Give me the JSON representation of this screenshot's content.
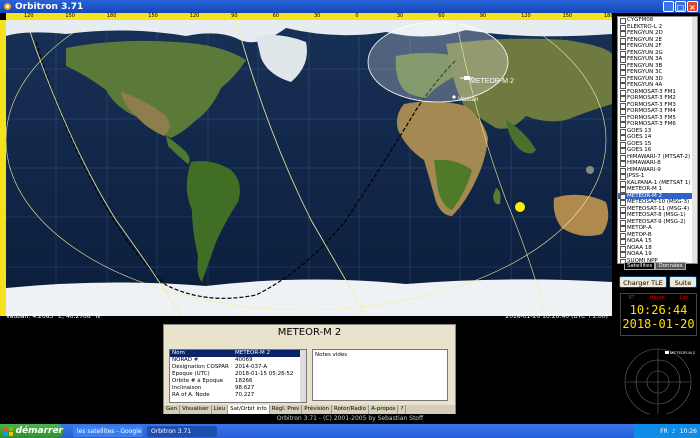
{
  "window": {
    "title": "Orbitron 3.71"
  },
  "map": {
    "top_scale": [
      "120",
      "150",
      "180",
      "150",
      "120",
      "90",
      "60",
      "30",
      "0",
      "30",
      "60",
      "90",
      "120",
      "150",
      "180"
    ],
    "satellite_label": "METEOR-M 2",
    "observer_label": "Vauban",
    "location_readout": "Vauban: 4.2083° E, 46.2708° N",
    "datetime_readout": "2018-01-20 10:26:40 (UTC +1:00)"
  },
  "panel": {
    "title": "METEOR-M 2",
    "table": [
      {
        "k": "Nom",
        "v": "METEOR-M 2"
      },
      {
        "k": "NORAD #",
        "v": "40069"
      },
      {
        "k": "Désignation COSPAR",
        "v": "2014-037-A"
      },
      {
        "k": "Epoque (UTC)",
        "v": "2018-01-15 05:26:52"
      },
      {
        "k": "Orbite # à Epoque",
        "v": "18266"
      },
      {
        "k": "Inclinaison",
        "v": "98.627"
      },
      {
        "k": "RA of A. Node",
        "v": "70.227"
      }
    ],
    "notes": "Notes vides",
    "tabs": [
      "Gen",
      "Visualiser",
      "Lieu",
      "Sat/Orbit info",
      "Régl. Prev",
      "Prévision",
      "Rotor/Radio",
      "A-propos",
      "?"
    ]
  },
  "satellites": [
    "CYGFM08",
    "ELEKTRO-L 2",
    "FENGYUN 2D",
    "FENGYUN 2E",
    "FENGYUN 2F",
    "FENGYUN 2G",
    "FENGYUN 3A",
    "FENGYUN 3B",
    "FENGYUN 3C",
    "FENGYUN 3D",
    "FENGYUN 4A",
    "FORMOSAT-3 FM1",
    "FORMOSAT-3 FM2",
    "FORMOSAT-3 FM3",
    "FORMOSAT-3 FM4",
    "FORMOSAT-3 FM5",
    "FORMOSAT-3 FM6",
    "GOES 13",
    "GOES 14",
    "GOES 15",
    "GOES 16",
    "HIMAWARI-7 (MTSAT-2)",
    "HIMAWARI-8",
    "HIMAWARI-9",
    "JPSS-1",
    "KALPANA-1 (METSAT 1)",
    "METEOR-M 1",
    "METEOR-M 2",
    "METEOSAT-10 (MSG-3)",
    "METEOSAT-11 (MSG-4)",
    "METEOSAT-8 (MSG-1)",
    "METEOSAT-9 (MSG-2)",
    "METOP-A",
    "METOP-B",
    "NOAA 15",
    "NOAA 18",
    "NOAA 19",
    "SUOMI NPP"
  ],
  "selected_index": 27,
  "checked_index": 27,
  "list_tabs": [
    "Satellites",
    "Données"
  ],
  "buttons": {
    "load_tle": "Charger TLE",
    "next": "Suite"
  },
  "clock": {
    "labels": [
      "RT",
      "Heure",
      "Loc"
    ],
    "time": "10:26:44",
    "date": "2018-01-20"
  },
  "radar_label": "METEOR-M 2",
  "infobar": "Orbitron 3.71 - (C) 2001-2005 by Sebastian Stoff",
  "taskbar": {
    "start": "démarrer",
    "tasks": [
      "les satellites - Google ...",
      "Orbitron 3.71"
    ],
    "tray_lang": "FR",
    "tray_time": "10:26"
  },
  "colors": {
    "accent_scale": "#f4e21c",
    "clock_text": "#ffe000",
    "selection": "#3163c5"
  }
}
